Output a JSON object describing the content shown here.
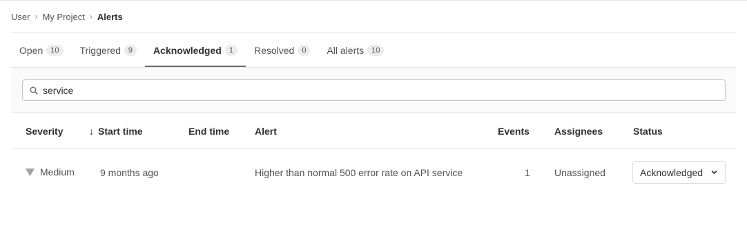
{
  "breadcrumb": {
    "items": [
      {
        "label": "User"
      },
      {
        "label": "My Project"
      },
      {
        "label": "Alerts"
      }
    ],
    "separator": "›"
  },
  "tabs": [
    {
      "label": "Open",
      "count": "10"
    },
    {
      "label": "Triggered",
      "count": "9"
    },
    {
      "label": "Acknowledged",
      "count": "1",
      "active": true
    },
    {
      "label": "Resolved",
      "count": "0"
    },
    {
      "label": "All alerts",
      "count": "10"
    }
  ],
  "search": {
    "value": "service",
    "icon": "search-icon"
  },
  "table": {
    "columns": {
      "severity": "Severity",
      "start_time": "Start time",
      "end_time": "End time",
      "alert": "Alert",
      "events": "Events",
      "assignees": "Assignees",
      "status": "Status"
    },
    "sort_icon": "arrow-down-icon",
    "rows": [
      {
        "severity": "Medium",
        "severity_icon": "triangle-down-icon",
        "start_time": "9 months ago",
        "end_time": "",
        "alert": "Higher than normal 500 error rate on API service",
        "events": "1",
        "assignees": "Unassigned",
        "status": "Acknowledged"
      }
    ]
  },
  "colors": {
    "text": "#303030",
    "muted_text": "#525252",
    "border": "#e5e5e5",
    "band_bg": "#fafafa",
    "severity_medium": "#a2a2a2",
    "tab_underline": "#666666"
  }
}
